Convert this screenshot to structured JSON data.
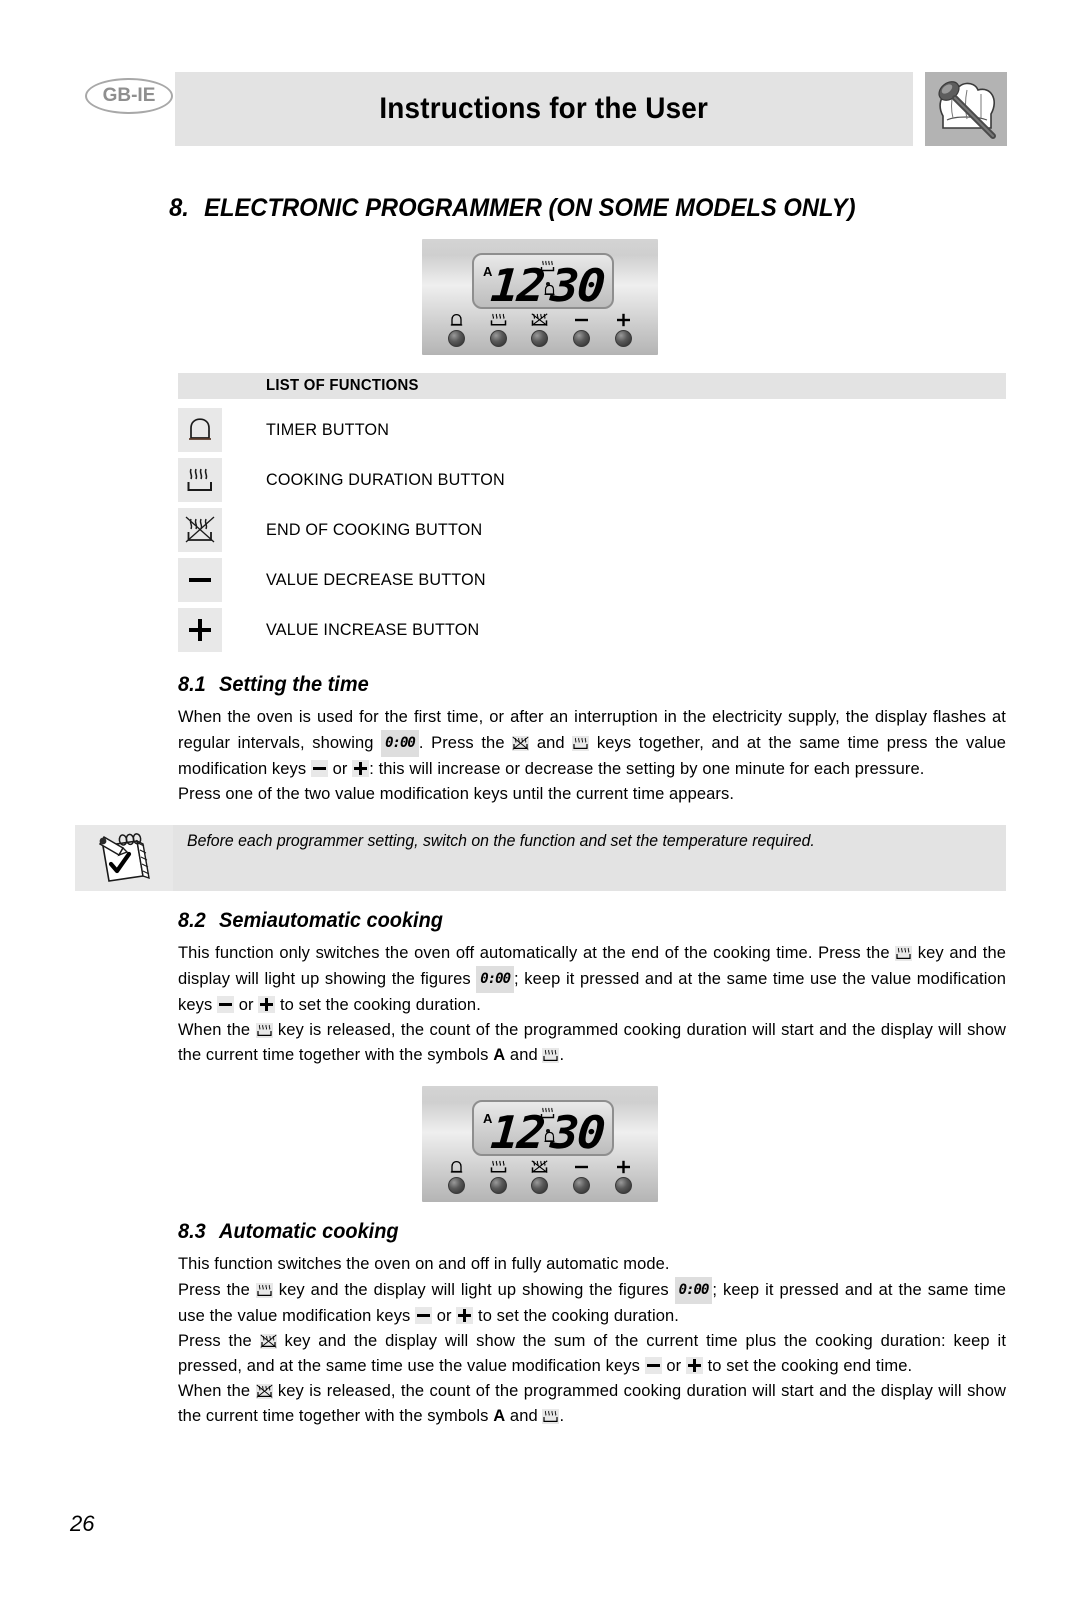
{
  "header": {
    "region_code": "GB-IE",
    "title": "Instructions for the User",
    "chef_icon": "chef-hat-spoon-icon"
  },
  "section": {
    "number": "8.",
    "title": "ELECTRONIC PROGRAMMER (ON SOME MODELS ONLY)"
  },
  "programmer_display": {
    "auto_indicator": "A",
    "hours": "12",
    "minutes": "30",
    "symbol_top": "cooking-duration-icon",
    "symbol_bottom": "timer-bell-icon",
    "buttons": [
      {
        "name": "timer-button",
        "icon": "bell-icon"
      },
      {
        "name": "cooking-duration-button",
        "icon": "heating-element-icon"
      },
      {
        "name": "end-of-cooking-button",
        "icon": "heating-element-crossed-icon"
      },
      {
        "name": "value-decrease-button",
        "icon": "minus-icon"
      },
      {
        "name": "value-increase-button",
        "icon": "plus-icon"
      }
    ]
  },
  "list_of_functions": {
    "heading": "LIST OF FUNCTIONS",
    "rows": [
      {
        "icon": "bell-icon",
        "label": "TIMER BUTTON"
      },
      {
        "icon": "heating-element-icon",
        "label": "COOKING DURATION BUTTON"
      },
      {
        "icon": "heating-element-crossed-icon",
        "label": "END OF COOKING BUTTON"
      },
      {
        "icon": "minus-icon",
        "label": "VALUE DECREASE BUTTON"
      },
      {
        "icon": "plus-icon",
        "label": "VALUE INCREASE BUTTON"
      }
    ]
  },
  "subsection_8_1": {
    "number": "8.1",
    "title": "Setting the time",
    "t1": "When the oven is used for the first time, or after an interruption in the electricity supply, the display flashes at regular intervals, showing",
    "lcd1": "0:00",
    "t2": ". Press the",
    "t3": "and",
    "t4": "keys together, and at the same time press the value modification keys",
    "t5": "or",
    "t6": ": this will increase or decrease the setting by one minute for each pressure.",
    "t7": "Press one of the two value modification keys until the current time appears."
  },
  "note": {
    "icon": "notepad-checkmark-icon",
    "text": "Before each programmer setting, switch on the function and set the temperature required."
  },
  "subsection_8_2": {
    "number": "8.2",
    "title": "Semiautomatic cooking",
    "t1": "This function only switches the oven off automatically at the end of the cooking time. Press the",
    "t2": "key and the display will light up showing the figures",
    "lcd1": "0:00",
    "t3": "; keep it pressed and at the same time use the value modification keys",
    "t4": "or",
    "t5": "to set the cooking duration.",
    "t6": "When the",
    "t7": "key is released, the count of the programmed cooking duration will start and the display will show the current time together with the symbols",
    "symbol_a": "A",
    "t8": "and",
    "t9": "."
  },
  "subsection_8_3": {
    "number": "8.3",
    "title": "Automatic cooking",
    "t1": "This function switches the oven on and off in fully automatic mode.",
    "t2": "Press the",
    "t3": "key and the display will light up showing the figures",
    "lcd1": "0:00",
    "t4": "; keep it pressed and at the same time use the value modification keys",
    "t5": "or",
    "t6": "to set the cooking duration.",
    "t7": "Press the",
    "t8": "key and the display will show the sum of the current time plus the cooking duration: keep it pressed, and at the same time use the value modification keys",
    "t9": "or",
    "t10": "to set the cooking end time.",
    "t11": "When the",
    "t12": "key is released, the count of the programmed cooking duration will start and the display will show the current time together with the symbols",
    "symbol_a": "A",
    "t13": "and",
    "t14": "."
  },
  "footer": {
    "page_number": "26"
  }
}
